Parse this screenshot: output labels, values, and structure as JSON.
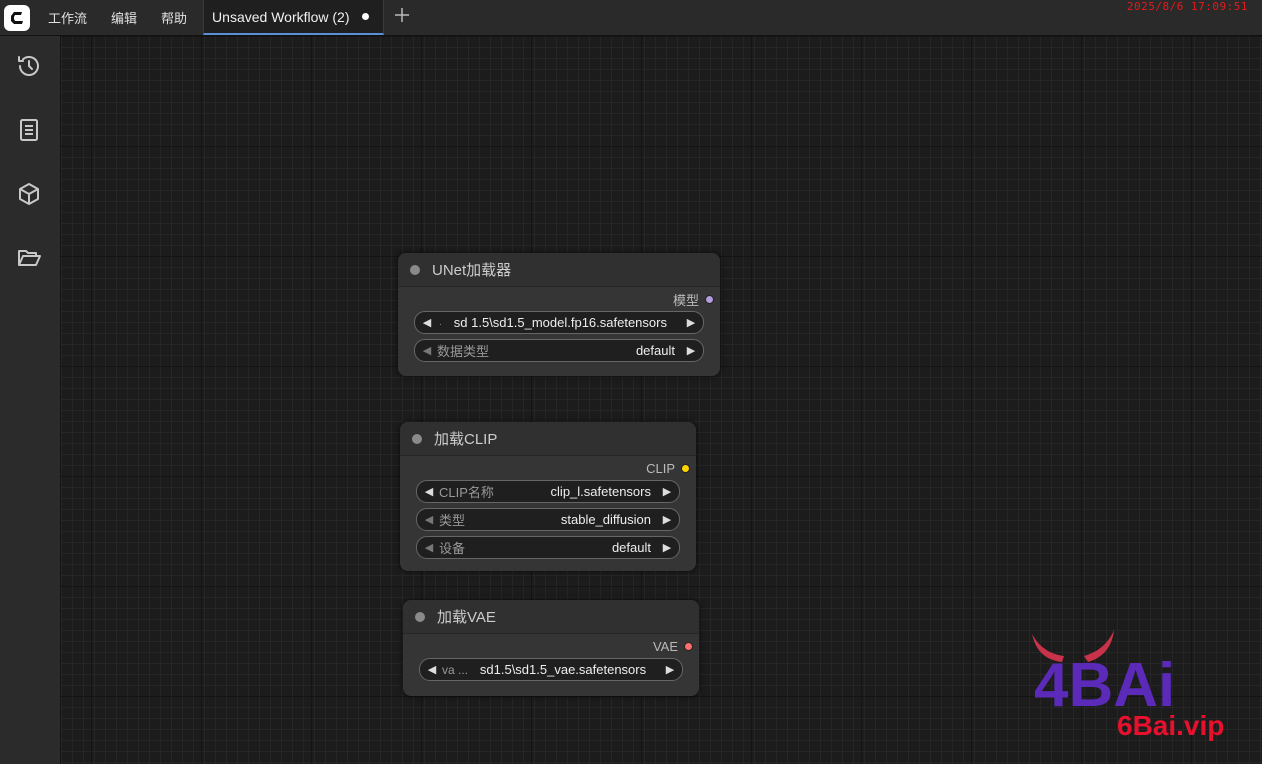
{
  "topbar": {
    "menu": [
      "工作流",
      "编辑",
      "帮助"
    ],
    "tab_title": "Unsaved Workflow (2)",
    "add_tab": "+",
    "clock": "2025/8/6 17:09:51"
  },
  "sidebar": {
    "items": [
      "history-icon",
      "book-icon",
      "cube-icon",
      "folder-open-icon"
    ]
  },
  "nodes": {
    "unet": {
      "title": "UNet加载器",
      "output": "模型",
      "output_color": "#b39ddb",
      "widgets": [
        {
          "label": "",
          "value": "sd 1.5\\sd1.5_model.fp16.safetensors"
        },
        {
          "label": "数据类型",
          "value": "default"
        }
      ]
    },
    "clip": {
      "title": "加载CLIP",
      "output": "CLIP",
      "output_color": "#ffd500",
      "widgets": [
        {
          "label": "CLIP名称",
          "value": "clip_l.safetensors"
        },
        {
          "label": "类型",
          "value": "stable_diffusion"
        },
        {
          "label": "设备",
          "value": "default"
        }
      ]
    },
    "vae": {
      "title": "加载VAE",
      "output": "VAE",
      "output_color": "#ff6e6e",
      "widgets": [
        {
          "label": "va  ...",
          "value": "sd1.5\\sd1.5_vae.safetensors"
        }
      ]
    }
  },
  "watermark": {
    "logo_text": "4BAi",
    "site": "6Bai.vip"
  },
  "colors": {
    "accent_tab": "#5b8fd6",
    "clock": "#e31b1b",
    "watermark_red": "#e8112d",
    "watermark_purple": "#5b2ab8"
  }
}
